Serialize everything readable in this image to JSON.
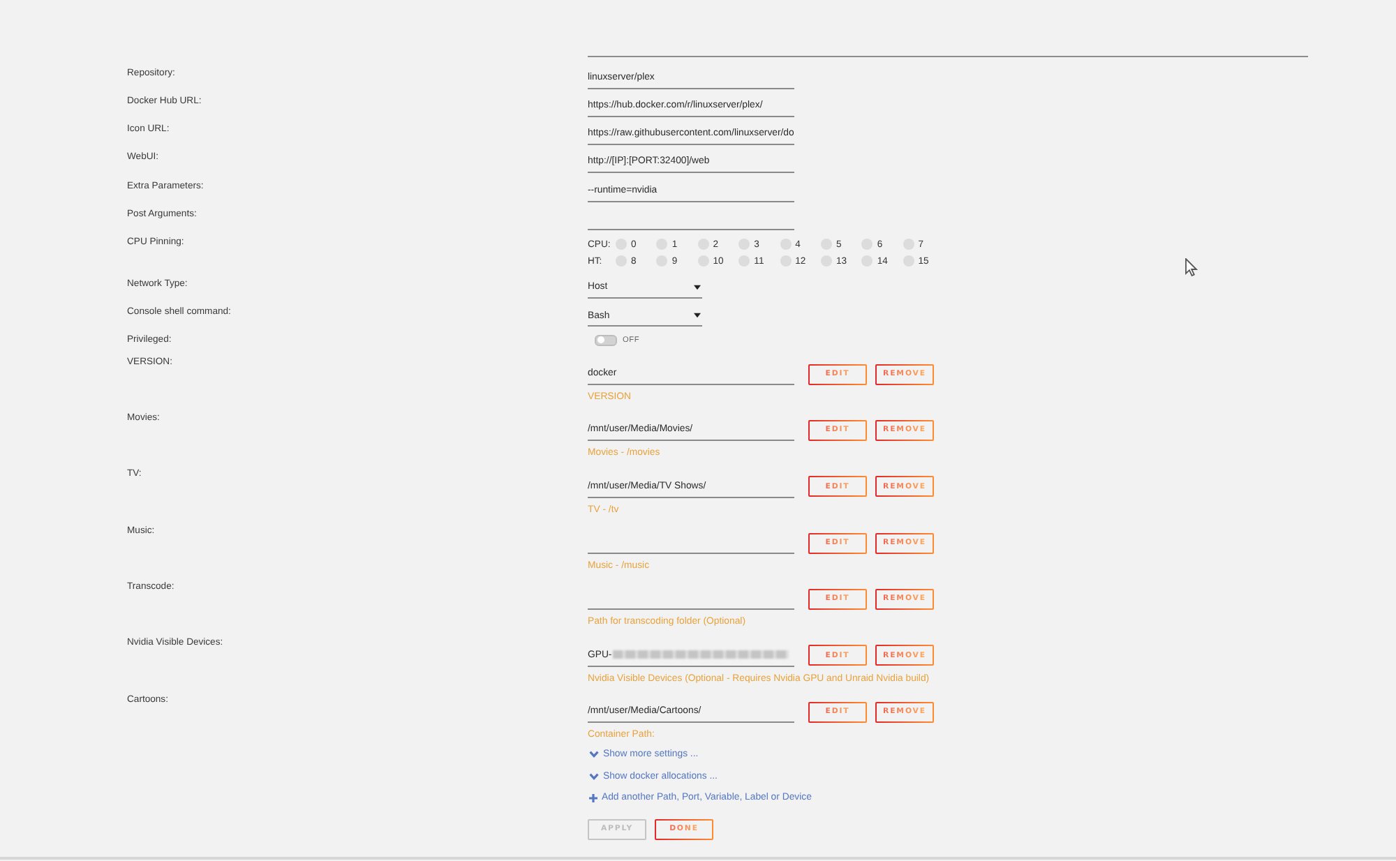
{
  "settings": [
    {
      "label": "Repository:",
      "value": "linuxserver/plex"
    },
    {
      "label": "Docker Hub URL:",
      "value": "https://hub.docker.com/r/linuxserver/plex/"
    },
    {
      "label": "Icon URL:",
      "value": "https://raw.githubusercontent.com/linuxserver/do"
    },
    {
      "label": "WebUI:",
      "value": "http://[IP]:[PORT:32400]/web"
    },
    {
      "label": "Extra Parameters:",
      "value": "--runtime=nvidia"
    },
    {
      "label": "Post Arguments:"
    }
  ],
  "cpu_pinning": {
    "label": "CPU Pinning:",
    "rows": [
      {
        "label": "CPU:",
        "cores": [
          {
            "label": "0",
            "checked": false
          },
          {
            "label": "1",
            "checked": false
          },
          {
            "label": "2",
            "checked": false
          },
          {
            "label": "3",
            "checked": false
          },
          {
            "label": "4",
            "checked": false
          },
          {
            "label": "5",
            "checked": false
          },
          {
            "label": "6",
            "checked": false
          },
          {
            "label": "7",
            "checked": false
          }
        ]
      },
      {
        "label": "HT:",
        "cores": [
          {
            "label": "8",
            "checked": false
          },
          {
            "label": "9",
            "checked": false
          },
          {
            "label": "10",
            "checked": false
          },
          {
            "label": "11",
            "checked": false
          },
          {
            "label": "12",
            "checked": false
          },
          {
            "label": "13",
            "checked": false
          },
          {
            "label": "14",
            "checked": false
          },
          {
            "label": "15",
            "checked": false
          }
        ]
      }
    ]
  },
  "dropdowns": [
    {
      "label": "Network Type:",
      "value": "Host"
    },
    {
      "label": "Console shell command:",
      "value": "Bash"
    }
  ],
  "privileged": {
    "label": "Privileged:",
    "on": false,
    "state_label": "OFF"
  },
  "config_items": [
    {
      "label": "VERSION:",
      "value": "docker",
      "redacted": false,
      "description": "VERSION",
      "actions": [
        "EDIT",
        "REMOVE"
      ]
    },
    {
      "label": "Movies:",
      "value": "/mnt/user/Media/Movies/",
      "redacted": false,
      "description": "Movies - /movies",
      "actions": [
        "EDIT",
        "REMOVE"
      ]
    },
    {
      "label": "TV:",
      "value": "/mnt/user/Media/TV Shows/",
      "redacted": false,
      "description": "TV - /tv",
      "actions": [
        "EDIT",
        "REMOVE"
      ]
    },
    {
      "label": "Music:",
      "redacted": false,
      "description": "Music - /music",
      "actions": [
        "EDIT",
        "REMOVE"
      ]
    },
    {
      "label": "Transcode:",
      "redacted": false,
      "description": "Path for transcoding folder (Optional)",
      "actions": [
        "EDIT",
        "REMOVE"
      ]
    },
    {
      "label": "Nvidia Visible Devices:",
      "value": "GPU-",
      "redacted": true,
      "description": "Nvidia Visible Devices (Optional - Requires Nvidia GPU and Unraid Nvidia build)",
      "actions": [
        "EDIT",
        "REMOVE"
      ]
    },
    {
      "label": "Cartoons:",
      "value": "/mnt/user/Media/Cartoons/",
      "redacted": false,
      "description": "Container Path:",
      "actions": [
        "EDIT",
        "REMOVE"
      ]
    }
  ],
  "links": [
    {
      "kind": "expand",
      "label": "Show more settings ..."
    },
    {
      "kind": "expand",
      "label": "Show docker allocations ..."
    },
    {
      "kind": "add",
      "label": "Add another Path, Port, Variable, Label or Device"
    }
  ],
  "buttons": [
    {
      "label": "APPLY",
      "disabled": true
    },
    {
      "label": "DONE",
      "disabled": false
    }
  ]
}
